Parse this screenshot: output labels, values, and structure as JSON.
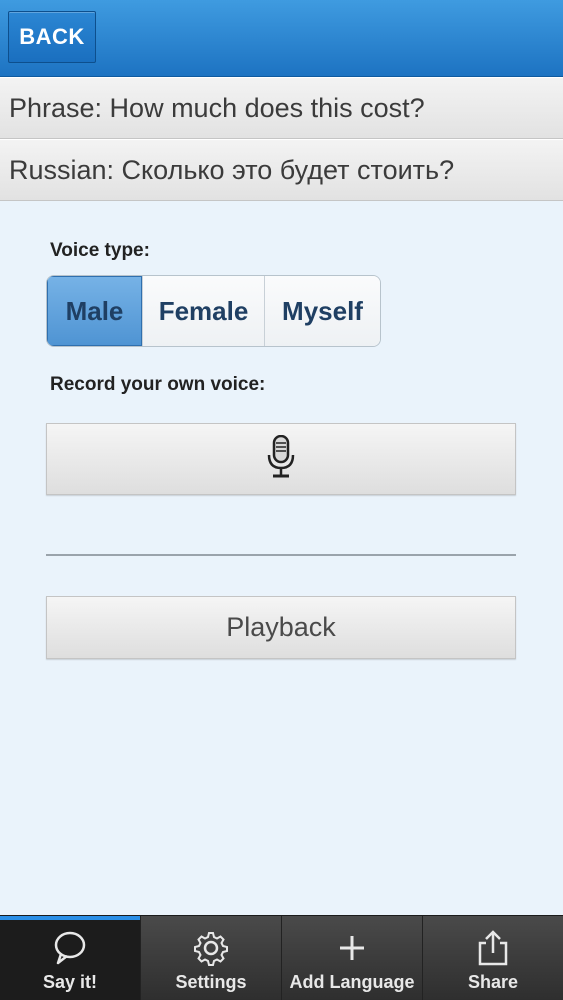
{
  "header": {
    "back_label": "BACK"
  },
  "phrase": {
    "text": "Phrase: How much does this cost?"
  },
  "translation": {
    "text": "Russian: Сколько это будет стоить?"
  },
  "voice_type": {
    "label": "Voice type:",
    "options": [
      "Male",
      "Female",
      "Myself"
    ],
    "selected": "Male"
  },
  "record": {
    "label": "Record your own voice:",
    "icon": "microphone-icon"
  },
  "playback": {
    "label": "Playback"
  },
  "tabbar": {
    "tabs": [
      {
        "label": "Say it!",
        "icon": "speech-bubble-icon",
        "active": true
      },
      {
        "label": "Settings",
        "icon": "gear-icon",
        "active": false
      },
      {
        "label": "Add Language",
        "icon": "plus-icon",
        "active": false
      },
      {
        "label": "Share",
        "icon": "share-icon",
        "active": false
      }
    ]
  },
  "colors": {
    "header_blue": "#1d73c2",
    "selected_segment": "#4f94d3",
    "active_tab_indicator": "#2a8ee6",
    "background": "#eaf3fb"
  }
}
